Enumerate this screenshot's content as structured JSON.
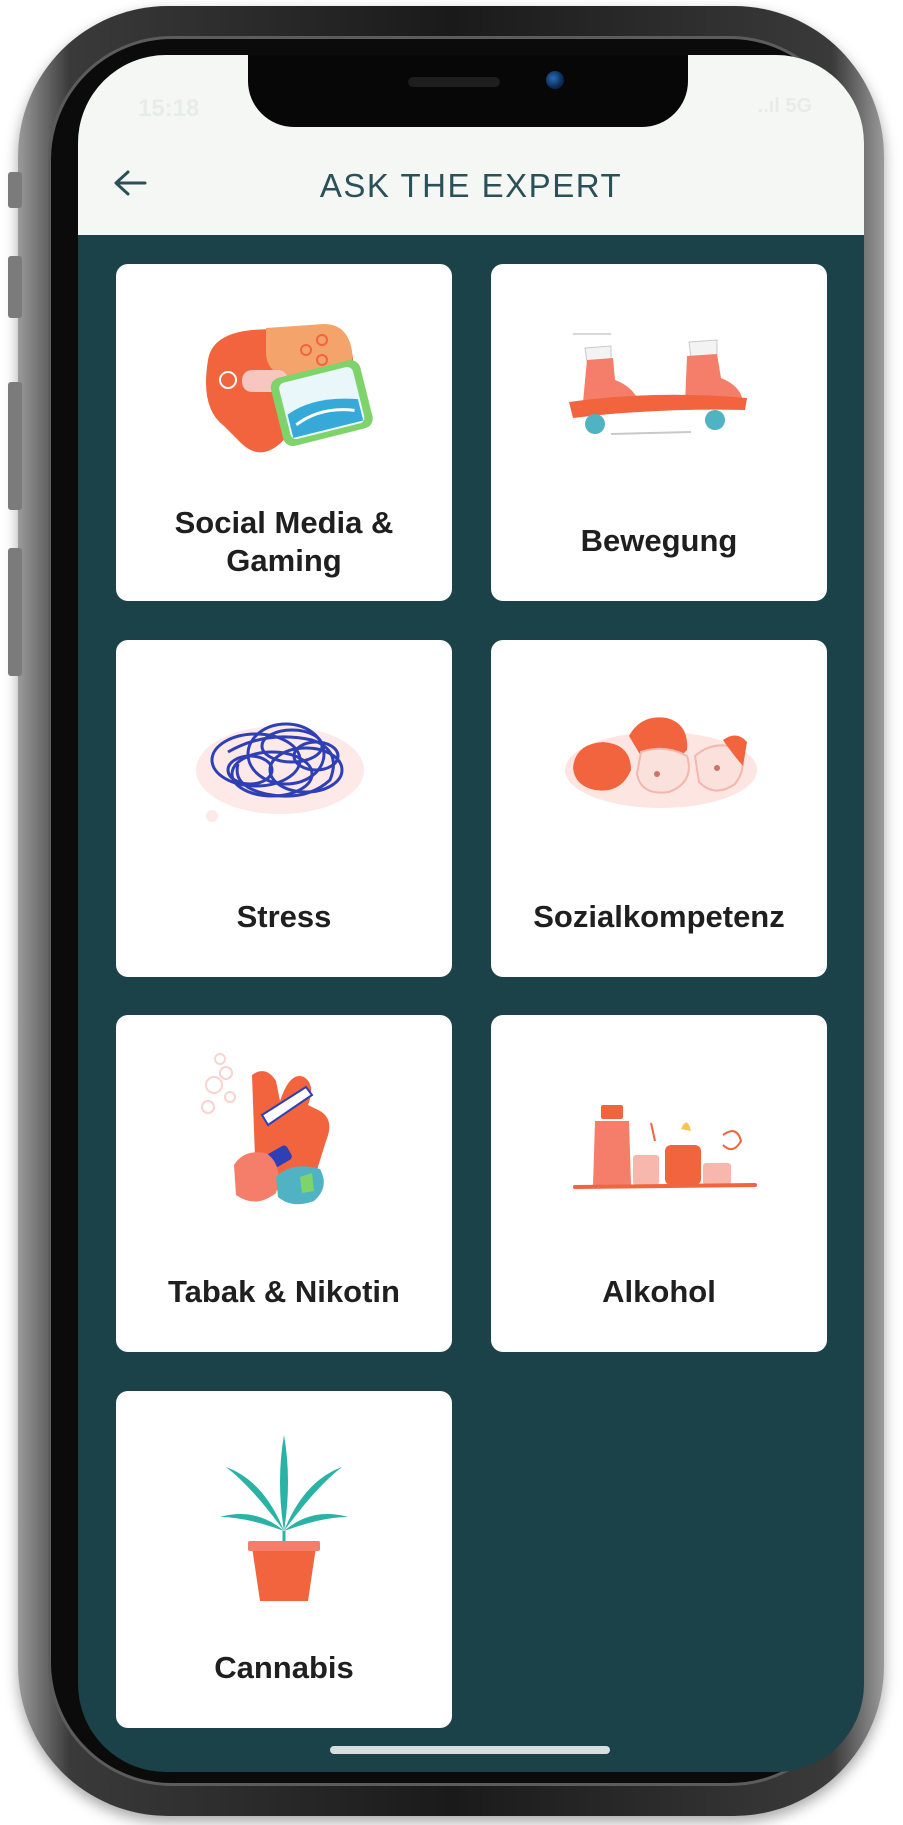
{
  "status_bar": {
    "time": "15:18",
    "right": "..ıl 5G"
  },
  "header": {
    "title": "ASK THE EXPERT",
    "back_icon": "arrow-left-icon"
  },
  "topics": [
    {
      "label_line1": "Social Media &",
      "label_line2": "Gaming",
      "icon": "game-controller-phone-icon"
    },
    {
      "label": "Bewegung",
      "icon": "skateboard-shoes-icon"
    },
    {
      "label": "Stress",
      "icon": "tangled-scribble-icon"
    },
    {
      "label": "Sozialkompetenz",
      "icon": "people-heads-icon"
    },
    {
      "label": "Tabak & Nikotin",
      "icon": "hand-cigarette-vape-icon"
    },
    {
      "label": "Alkohol",
      "icon": "bottles-glasses-icon"
    },
    {
      "label": "Cannabis",
      "icon": "cannabis-plant-pot-icon"
    }
  ],
  "colors": {
    "background": "#1a4248",
    "header": "#f5f7f5",
    "title": "#2b5158",
    "card": "#ffffff",
    "accent": "#f1643e"
  }
}
